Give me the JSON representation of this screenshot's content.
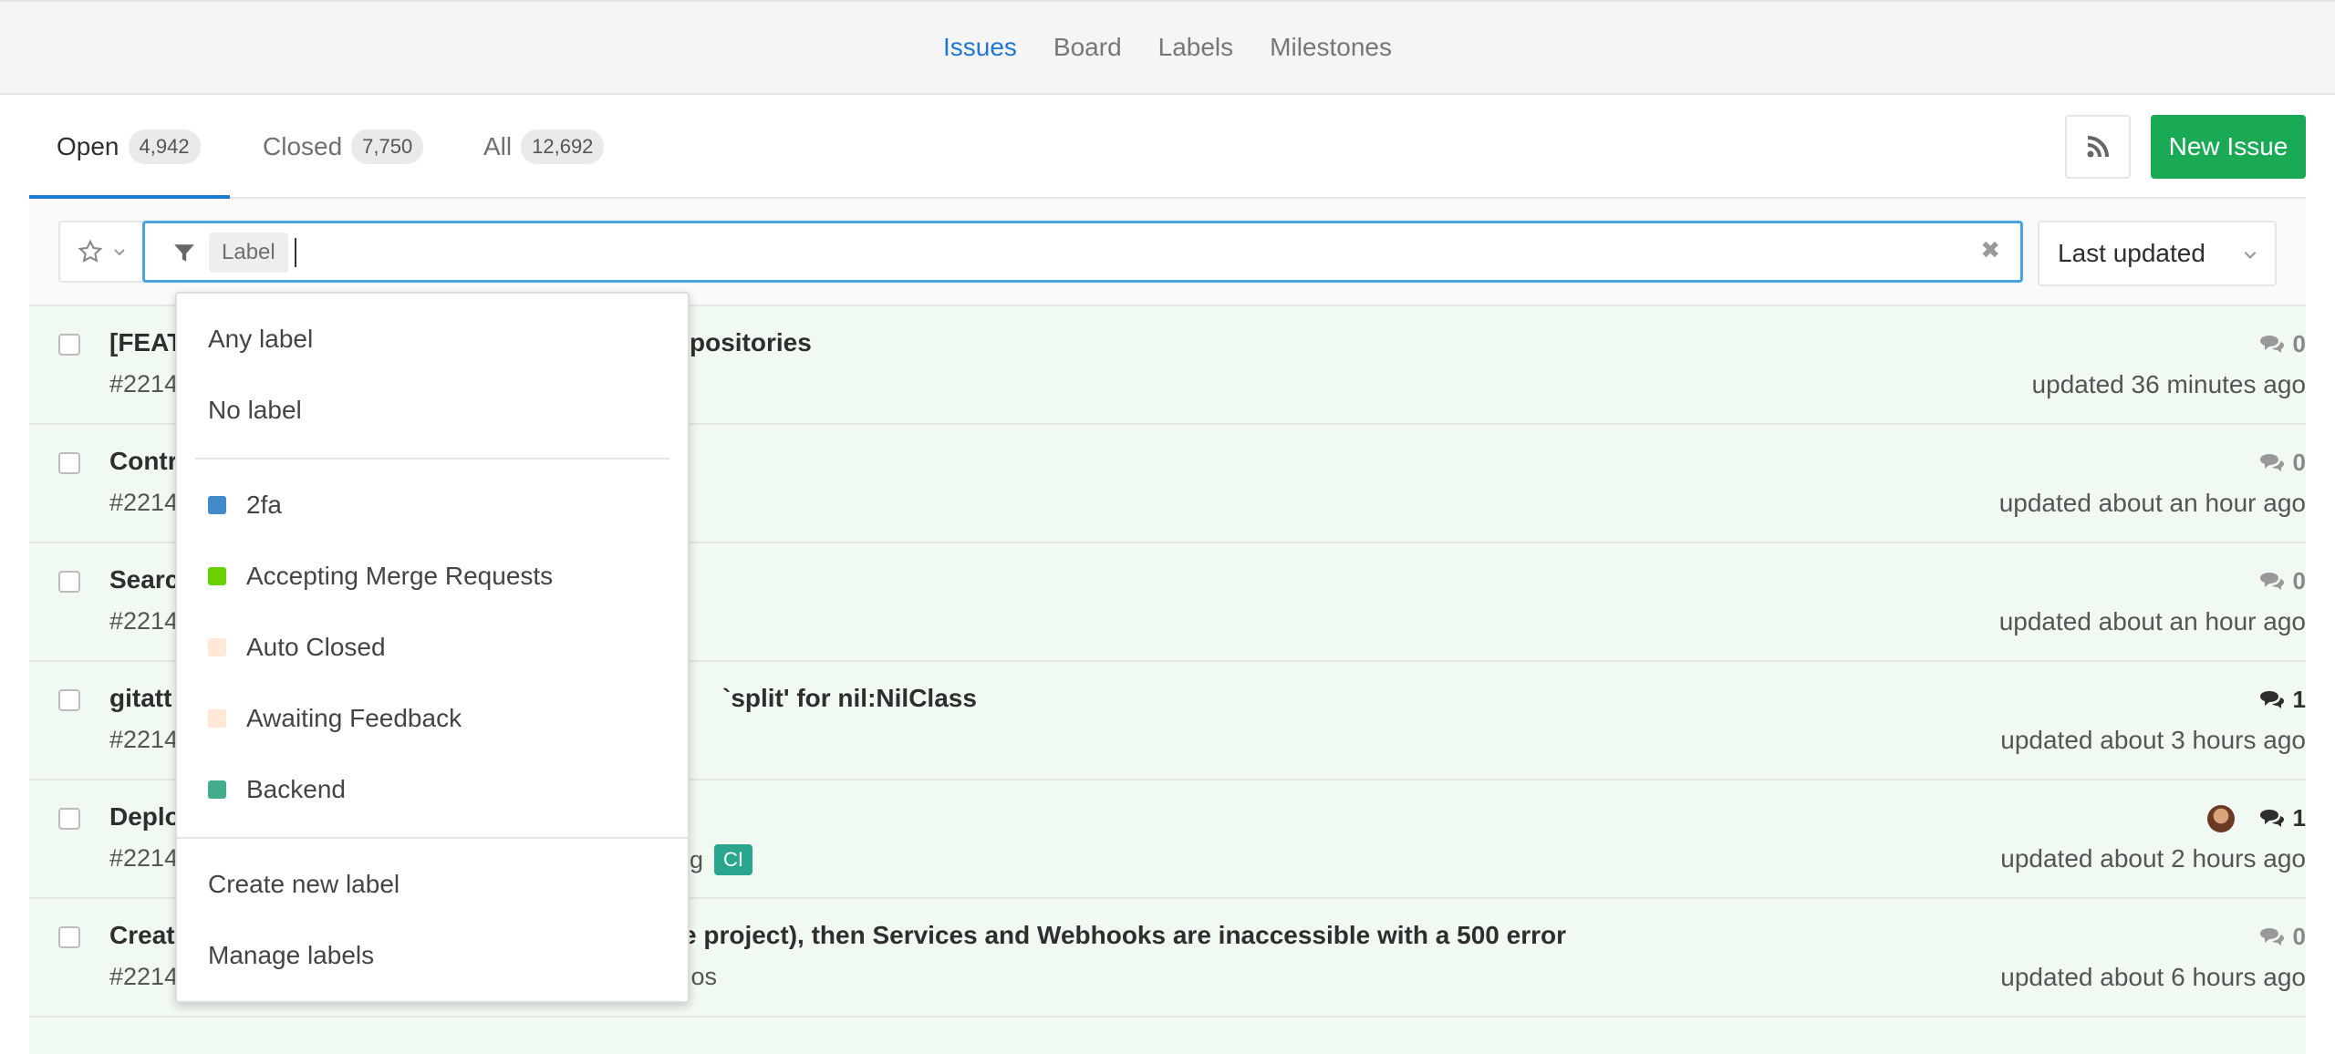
{
  "subnav": {
    "items": [
      {
        "label": "Issues",
        "active": true
      },
      {
        "label": "Board"
      },
      {
        "label": "Labels"
      },
      {
        "label": "Milestones"
      }
    ]
  },
  "tabs": {
    "open": {
      "label": "Open",
      "count": "4,942"
    },
    "closed": {
      "label": "Closed",
      "count": "7,750"
    },
    "all": {
      "label": "All",
      "count": "12,692"
    }
  },
  "actions": {
    "new_issue": "New Issue",
    "rss_icon": "rss-icon"
  },
  "filter": {
    "token": "Label",
    "clear_icon": "✖",
    "sort_value": "Last updated"
  },
  "dropdown": {
    "any": "Any label",
    "none": "No label",
    "labels": [
      {
        "name": "2fa",
        "color": "#428bca"
      },
      {
        "name": "Accepting Merge Requests",
        "color": "#69d100"
      },
      {
        "name": "Auto Closed",
        "color": "#fee9d9"
      },
      {
        "name": "Awaiting Feedback",
        "color": "#fee9d9"
      },
      {
        "name": "Backend",
        "color": "#44ad8e"
      }
    ],
    "create": "Create new label",
    "manage": "Manage labels"
  },
  "issues": [
    {
      "title_head": "[FEAT",
      "title_tail": "positories",
      "ref": "#2214",
      "comments": "0",
      "updated": "updated 36 minutes ago"
    },
    {
      "title_head": "Contr",
      "title_tail": "",
      "ref": "#2214",
      "comments": "0",
      "updated": "updated about an hour ago"
    },
    {
      "title_head": "Searc",
      "title_tail": "",
      "ref": "#2214",
      "comments": "0",
      "updated": "updated about an hour ago"
    },
    {
      "title_head": "gitatt",
      "title_tail": "`split' for nil:NilClass",
      "ref": "#2214",
      "comments": "1",
      "updated": "updated about 3 hours ago"
    },
    {
      "title_head": "Deplo",
      "title_tail": "",
      "ref": "#2214",
      "ref_tail": "g",
      "badge": "CI",
      "comments": "1",
      "updated": "updated about 2 hours ago"
    },
    {
      "title_head": "Creat",
      "title_tail": "e project), then Services and Webhooks are inaccessible with a 500 error",
      "ref": "#2214",
      "ref_tail": "flos",
      "comments": "0",
      "updated": "updated about 6 hours ago"
    }
  ]
}
